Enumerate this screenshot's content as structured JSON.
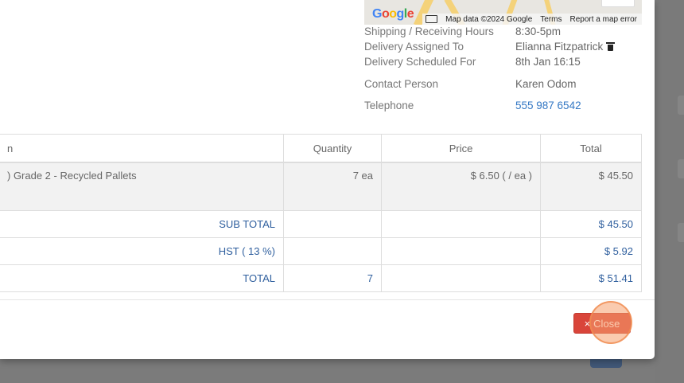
{
  "map": {
    "logo": [
      "G",
      "o",
      "o",
      "g",
      "l",
      "e"
    ],
    "attribution": {
      "map_data": "Map data ©2024 Google",
      "terms": "Terms",
      "report": "Report a map error"
    }
  },
  "details": [
    {
      "label": "Shipping / Receiving Hours",
      "value": "8:30-5pm"
    },
    {
      "label": "Delivery Assigned To",
      "value": "Elianna Fitzpatrick"
    },
    {
      "label": "Delivery Scheduled For",
      "value": "8th Jan 16:15"
    },
    {
      "label": "Contact Person",
      "value": "Karen Odom"
    },
    {
      "label": "Telephone",
      "value": "555 987 6542"
    }
  ],
  "table": {
    "headers": [
      "n",
      "Quantity",
      "Price",
      "Total"
    ],
    "item": {
      "name": ") Grade 2 - Recycled Pallets",
      "quantity": "7 ea",
      "price": "$ 6.50 ( / ea )",
      "total": "$ 45.50"
    },
    "subtotal": {
      "label": "SUB TOTAL",
      "value": "$ 45.50"
    },
    "tax": {
      "label": "HST ( 13 %)",
      "value": "$ 5.92"
    },
    "total": {
      "label": "TOTAL",
      "quantity": "7",
      "value": "$ 51.41"
    }
  },
  "footer": {
    "close_label": "Close"
  },
  "colors": {
    "link": "#3478c4",
    "close_button": "#d9453a"
  }
}
